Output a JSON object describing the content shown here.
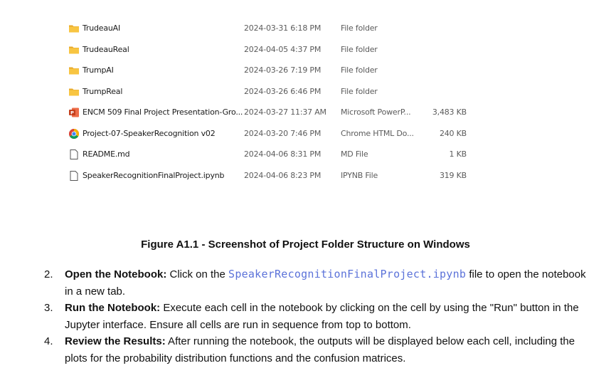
{
  "files": [
    {
      "name": "TrudeauAI",
      "date": "2024-03-31 6:18 PM",
      "type": "File folder",
      "size": "",
      "icon": "folder-icon"
    },
    {
      "name": "TrudeauReal",
      "date": "2024-04-05 4:37 PM",
      "type": "File folder",
      "size": "",
      "icon": "folder-icon"
    },
    {
      "name": "TrumpAI",
      "date": "2024-03-26 7:19 PM",
      "type": "File folder",
      "size": "",
      "icon": "folder-icon"
    },
    {
      "name": "TrumpReal",
      "date": "2024-03-26 6:46 PM",
      "type": "File folder",
      "size": "",
      "icon": "folder-icon"
    },
    {
      "name": "ENCM 509 Final Project Presentation-Gro...",
      "date": "2024-03-27 11:37 AM",
      "type": "Microsoft PowerP...",
      "size": "3,483 KB",
      "icon": "powerpoint-icon"
    },
    {
      "name": "Project-07-SpeakerRecognition v02",
      "date": "2024-03-20 7:46 PM",
      "type": "Chrome HTML Do...",
      "size": "240 KB",
      "icon": "chrome-icon"
    },
    {
      "name": "README.md",
      "date": "2024-04-06 8:31 PM",
      "type": "MD File",
      "size": "1 KB",
      "icon": "file-icon"
    },
    {
      "name": "SpeakerRecognitionFinalProject.ipynb",
      "date": "2024-04-06 8:23 PM",
      "type": "IPYNB File",
      "size": "319 KB",
      "icon": "file-icon"
    }
  ],
  "colors": {
    "folder": "#f8c542",
    "code": "#5b72d9",
    "powerpoint": "#c43e1c"
  },
  "caption": "Figure A1.1 - Screenshot of Project Folder Structure on Windows",
  "steps": [
    {
      "num": "2.",
      "title": "Open the Notebook:",
      "pre": " Click on the ",
      "code": "SpeakerRecognitionFinalProject.ipynb",
      "post": " file to open the notebook in a new tab."
    },
    {
      "num": "3.",
      "title": "Run the Notebook:",
      "text": " Execute each cell in the notebook by clicking on the cell by using the \"Run\" button in the Jupyter interface. Ensure all cells are run in sequence from top to bottom."
    },
    {
      "num": "4.",
      "title": "Review the Results:",
      "text": " After running the notebook, the outputs will be displayed below each cell, including the plots for the probability distribution functions and the confusion matrices."
    }
  ]
}
